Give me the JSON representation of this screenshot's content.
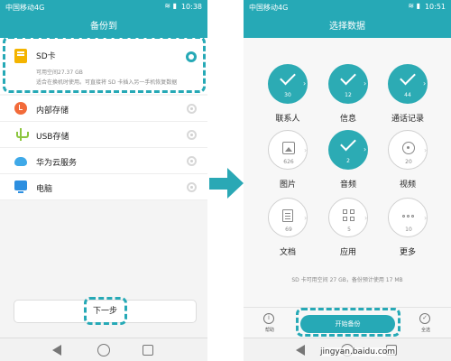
{
  "colors": {
    "accent": "#26a9b6",
    "dash": "#26a9b6",
    "arrow": "#2aa8b5"
  },
  "left": {
    "status": {
      "carrier": "中国移动4G",
      "time": "10:38",
      "icons": "≋ ▮"
    },
    "title": "备份到",
    "sd_option": {
      "icon": "sd-card-icon",
      "label": "SD卡",
      "space": "可用空间27.37 GB",
      "description": "适合在换机时使用。可直接将 SD 卡插入另一手机恢复数据",
      "selected": true
    },
    "options": [
      {
        "icon": "internal-storage-icon",
        "label": "内部存储",
        "selected": false
      },
      {
        "icon": "usb-icon",
        "label": "USB存储",
        "selected": false
      },
      {
        "icon": "cloud-icon",
        "label": "华为云服务",
        "selected": false
      },
      {
        "icon": "computer-icon",
        "label": "电脑",
        "selected": false
      }
    ],
    "next_label": "下一步"
  },
  "right": {
    "status": {
      "carrier": "中国移动4G",
      "time": "10:51",
      "icons": "≋ ▮"
    },
    "title": "选择数据",
    "categories": [
      {
        "label": "联系人",
        "count": "30",
        "selected": true,
        "icon": "check-icon"
      },
      {
        "label": "信息",
        "count": "12",
        "selected": true,
        "icon": "check-icon"
      },
      {
        "label": "通话记录",
        "count": "44",
        "selected": true,
        "icon": "check-icon"
      },
      {
        "label": "图片",
        "count": "626",
        "selected": false,
        "icon": "image-icon"
      },
      {
        "label": "音频",
        "count": "2",
        "selected": true,
        "icon": "check-icon"
      },
      {
        "label": "视频",
        "count": "20",
        "selected": false,
        "icon": "video-icon"
      },
      {
        "label": "文档",
        "count": "69",
        "selected": false,
        "icon": "document-icon"
      },
      {
        "label": "应用",
        "count": "5",
        "selected": false,
        "icon": "apps-icon"
      },
      {
        "label": "更多",
        "count": "10",
        "selected": false,
        "icon": "more-icon"
      }
    ],
    "summary": "SD 卡可用空间 27 GB，备份预计使用 17 MB",
    "help_label": "帮助",
    "start_label": "开始备份",
    "select_all_label": "全选"
  },
  "watermark": "jingyan.baidu.com"
}
